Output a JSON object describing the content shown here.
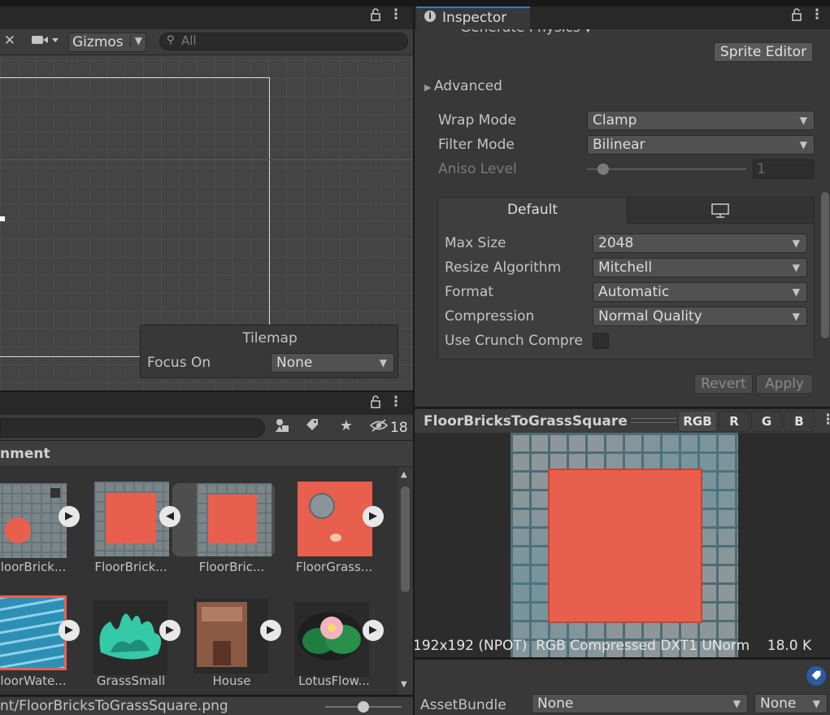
{
  "scene": {
    "gizmos_label": "Gizmos",
    "search_placeholder": "All"
  },
  "tilemap_overlay": {
    "title": "Tilemap",
    "focus_label": "Focus On",
    "focus_value": "None"
  },
  "project": {
    "folder_title": "nment",
    "hidden_count": "18",
    "assets": [
      {
        "label": "loorBrick..."
      },
      {
        "label": "FloorBrick..."
      },
      {
        "label": "FloorBric..."
      },
      {
        "label": "FloorGrass..."
      },
      {
        "label": "loorWate..."
      },
      {
        "label": "GrassSmall"
      },
      {
        "label": "House"
      },
      {
        "label": "LotusFlow..."
      }
    ],
    "path": "nt/FloorBricksToGrassSquare.png"
  },
  "inspector": {
    "tab_label": "Inspector",
    "generate_physics": "Generate Physics",
    "sprite_editor": "Sprite Editor",
    "advanced_label": "Advanced",
    "wrap_mode_label": "Wrap Mode",
    "wrap_mode_value": "Clamp",
    "filter_mode_label": "Filter Mode",
    "filter_mode_value": "Bilinear",
    "aniso_label": "Aniso Level",
    "aniso_value": "1",
    "aniso_fraction": 0.1,
    "platform_default": "Default",
    "max_size_label": "Max Size",
    "max_size_value": "2048",
    "resize_label": "Resize Algorithm",
    "resize_value": "Mitchell",
    "format_label": "Format",
    "format_value": "Automatic",
    "compression_label": "Compression",
    "compression_value": "Normal Quality",
    "crunch_label": "Use Crunch Compre",
    "revert": "Revert",
    "apply": "Apply"
  },
  "preview": {
    "title": "FloorBricksToGrassSquare",
    "channels": [
      "RGB",
      "R",
      "G",
      "B"
    ],
    "info": "192x192 (NPOT)  RGB Compressed DXT1 UNorm    18.0 K"
  },
  "assetbundle": {
    "label": "AssetBundle",
    "value": "None",
    "variant": "None"
  },
  "colors": {
    "accent_tab": "#3a79bb",
    "grass_red": "#e95f4d"
  }
}
